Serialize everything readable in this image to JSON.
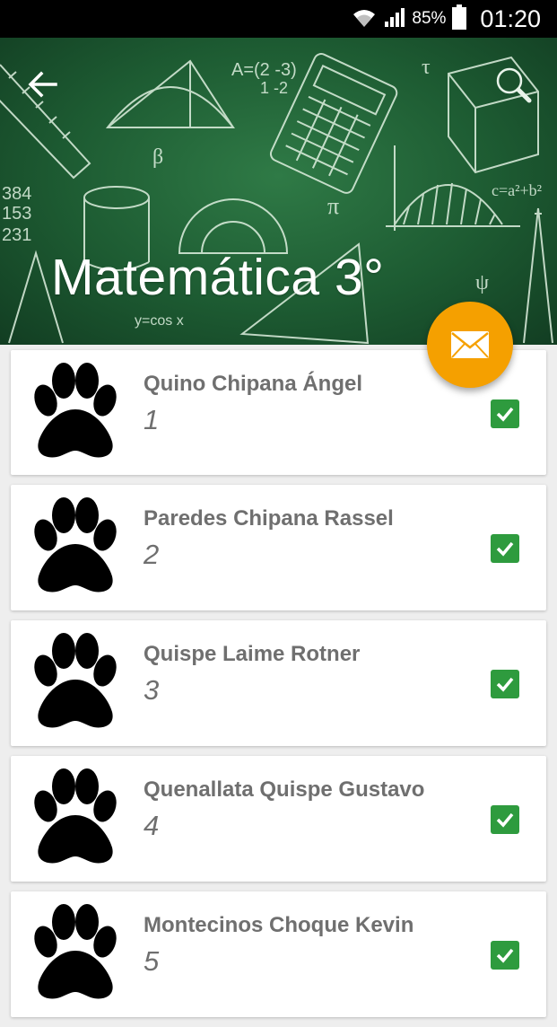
{
  "status_bar": {
    "battery_percent": "85%",
    "time": "01:20",
    "icons": [
      "wifi-icon",
      "signal-icon",
      "battery-icon"
    ]
  },
  "header": {
    "title": "Matemática 3°",
    "back_icon": "arrow-left-icon",
    "search_icon": "search-icon",
    "background": "green-chalkboard-math-illustration"
  },
  "fab": {
    "icon": "mail-icon",
    "color": "#f5a000"
  },
  "students": [
    {
      "name": "Quino Chipana Ángel",
      "number": "1",
      "checked": true
    },
    {
      "name": "Paredes Chipana Rassel",
      "number": "2",
      "checked": true
    },
    {
      "name": "Quispe Laime Rotner",
      "number": "3",
      "checked": true
    },
    {
      "name": "Quenallata Quispe Gustavo",
      "number": "4",
      "checked": true
    },
    {
      "name": "Montecinos Choque Kevin",
      "number": "5",
      "checked": true
    }
  ],
  "colors": {
    "accent": "#f5a000",
    "check": "#2e9b3e",
    "header": "#1f5f34",
    "text": "#6f6f6f"
  }
}
